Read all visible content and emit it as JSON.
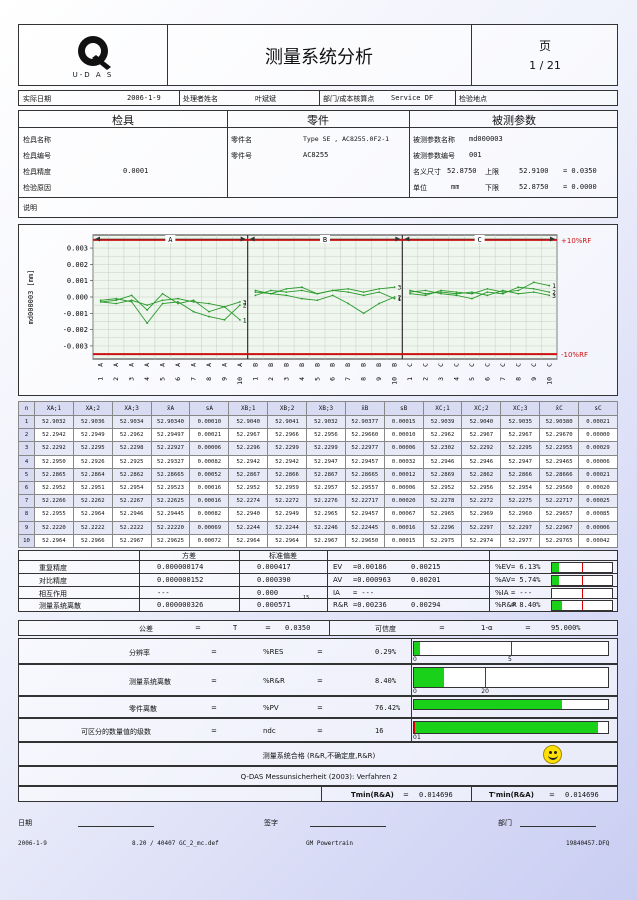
{
  "header": {
    "logo_text": "U-D A S",
    "title": "测量系统分析",
    "page_label": "页",
    "page_value": "1 / 21"
  },
  "info_row": {
    "date_label": "实际日期",
    "date_value": "2006-1-9",
    "operator_label": "处理者姓名",
    "operator_value": "叶斌斌",
    "dept_label": "部门/成本核算点",
    "dept_value": "Service DF",
    "inspect_label": "检验地点",
    "inspect_value": ""
  },
  "sections": {
    "gauge": "检具",
    "part": "零件",
    "characteristic": "被测参数"
  },
  "gauge": {
    "name_label": "检具名称",
    "name_value": "",
    "number_label": "检具编号",
    "number_value": "",
    "resolution_label": "检具精度",
    "resolution_value": "0.0001",
    "reason_label": "检验原因",
    "reason_value": ""
  },
  "part": {
    "name_label": "零件名",
    "name_value": "Type SE , AC8255.0F2-1",
    "number_label": "零件号",
    "number_value": "AC8255"
  },
  "characteristic": {
    "name_label": "被测参数名称",
    "name_value": "md000003",
    "number_label": "被测参数编号",
    "number_value": "001",
    "nominal_label": "名义尺寸",
    "nominal_value": "52.8750",
    "usl_label": "上限",
    "usl_value": "52.9100",
    "usl_dev": "= 0.0350",
    "unit_label": "单位",
    "unit_value": "mm",
    "lsl_label": "下限",
    "lsl_value": "52.8750",
    "lsl_dev": "= 0.0000",
    "remark_label": "说明"
  },
  "chart_data": {
    "type": "line",
    "ylabel": "md000003 [mm]",
    "ylim": [
      -0.0038,
      0.0038
    ],
    "yticks": [
      "0.003",
      "0.002",
      "0.001",
      "0.000",
      "-0.001",
      "-0.002",
      "-0.003"
    ],
    "upper_limit_label": "+10%RF",
    "lower_limit_label": "-10%RF",
    "limits": [
      0.0035,
      -0.0035
    ],
    "groups": [
      "A",
      "B",
      "C"
    ],
    "parts_per_group": 10,
    "x_letters": [
      "A",
      "A",
      "A",
      "A",
      "A",
      "A",
      "A",
      "A",
      "A",
      "A",
      "B",
      "B",
      "B",
      "B",
      "B",
      "B",
      "B",
      "B",
      "B",
      "B",
      "C",
      "C",
      "C",
      "C",
      "C",
      "C",
      "C",
      "C",
      "C",
      "C"
    ],
    "x_numbers": [
      "1",
      "2",
      "3",
      "4",
      "5",
      "6",
      "7",
      "8",
      "9",
      "10",
      "1",
      "2",
      "3",
      "4",
      "5",
      "6",
      "7",
      "8",
      "9",
      "10",
      "1",
      "2",
      "3",
      "4",
      "5",
      "6",
      "7",
      "8",
      "9",
      "10"
    ],
    "series": [
      {
        "name": "1",
        "group": "A",
        "values": [
          -0.0003,
          -0.0004,
          -0.0002,
          -0.0005,
          -0.0002,
          -0.0001,
          -0.0003,
          -0.0004,
          -0.0006,
          -0.0014
        ]
      },
      {
        "name": "2",
        "group": "A",
        "values": [
          -0.0002,
          -0.0001,
          -0.0003,
          -0.0016,
          -0.0004,
          -0.0003,
          -0.0009,
          -0.0012,
          -0.0014,
          -0.0005
        ]
      },
      {
        "name": "3",
        "group": "A",
        "values": [
          -0.0003,
          -0.0002,
          0.0001,
          -0.0008,
          0.0002,
          -0.0004,
          -0.0002,
          -0.0009,
          -0.0006,
          -0.0003
        ]
      },
      {
        "name": "1",
        "group": "B",
        "values": [
          0.0001,
          0.0004,
          0.0003,
          0.0004,
          0.0002,
          0.0004,
          0.0003,
          0.0001,
          0.0003,
          -0.0001
        ]
      },
      {
        "name": "2",
        "group": "B",
        "values": [
          0.0003,
          0.0002,
          0.0001,
          -0.0001,
          -0.0002,
          0.0001,
          -0.0004,
          -0.001,
          -0.0004,
          0.0
        ]
      },
      {
        "name": "3",
        "group": "B",
        "values": [
          0.0004,
          0.0002,
          0.0005,
          0.0006,
          0.0002,
          0.0004,
          0.0005,
          0.0003,
          0.0005,
          0.0006
        ]
      },
      {
        "name": "1",
        "group": "C",
        "values": [
          0.0002,
          0.0001,
          0.0004,
          0.0003,
          0.0002,
          0.0005,
          0.0003,
          0.0004,
          0.0009,
          0.0007
        ]
      },
      {
        "name": "2",
        "group": "C",
        "values": [
          0.0003,
          0.0004,
          0.0002,
          0.0001,
          -0.0001,
          0.0003,
          0.0002,
          0.0006,
          0.0005,
          0.0003
        ]
      },
      {
        "name": "3",
        "group": "C",
        "values": [
          0.0004,
          0.0002,
          0.0003,
          0.0002,
          0.0003,
          0.0001,
          0.0004,
          0.0002,
          0.0003,
          0.0001
        ]
      }
    ]
  },
  "data_table": {
    "headers": [
      "n",
      "XA;1",
      "XA;2",
      "XA;3",
      "x̄A",
      "sA",
      "XB;1",
      "XB;2",
      "XB;3",
      "x̄B",
      "sB",
      "XC;1",
      "XC;2",
      "XC;3",
      "x̄C",
      "sC"
    ],
    "rows": [
      [
        "1",
        "52.9032",
        "52.9036",
        "52.9034",
        "52.90340",
        "0.00010",
        "52.9040",
        "52.9041",
        "52.9032",
        "52.90377",
        "0.00015",
        "52.9039",
        "52.9040",
        "52.9035",
        "52.90380",
        "0.00021"
      ],
      [
        "2",
        "52.2942",
        "52.2949",
        "52.2962",
        "52.29497",
        "0.00021",
        "52.2967",
        "52.2966",
        "52.2956",
        "52.29660",
        "0.00010",
        "52.2962",
        "52.2967",
        "52.2967",
        "52.29670",
        "0.00000"
      ],
      [
        "3",
        "52.2292",
        "52.2295",
        "52.2298",
        "52.22927",
        "0.00006",
        "52.2296",
        "52.2299",
        "52.2299",
        "52.22977",
        "0.00006",
        "52.2302",
        "52.2292",
        "52.2295",
        "52.22955",
        "0.00029"
      ],
      [
        "4",
        "52.2950",
        "52.2926",
        "52.2925",
        "52.29327",
        "0.00082",
        "52.2942",
        "52.2942",
        "52.2947",
        "52.29457",
        "0.00032",
        "52.2946",
        "52.2946",
        "52.2947",
        "52.29465",
        "0.00006"
      ],
      [
        "5",
        "52.2865",
        "52.2864",
        "52.2862",
        "52.28665",
        "0.00052",
        "52.2867",
        "52.2866",
        "52.2867",
        "52.28665",
        "0.00012",
        "52.2869",
        "52.2862",
        "52.2866",
        "52.28666",
        "0.00021"
      ],
      [
        "6",
        "52.2952",
        "52.2951",
        "52.2954",
        "52.29523",
        "0.00016",
        "52.2952",
        "52.2959",
        "52.2957",
        "52.29557",
        "0.00006",
        "52.2952",
        "52.2956",
        "52.2954",
        "52.29560",
        "0.00020"
      ],
      [
        "7",
        "52.2266",
        "52.2262",
        "52.2267",
        "52.22625",
        "0.00016",
        "52.2274",
        "52.2272",
        "52.2276",
        "52.22717",
        "0.00020",
        "52.2278",
        "52.2272",
        "52.2275",
        "52.22717",
        "0.00025"
      ],
      [
        "8",
        "52.2955",
        "52.2964",
        "52.2946",
        "52.29445",
        "0.00082",
        "52.2940",
        "52.2949",
        "52.2965",
        "52.29457",
        "0.00067",
        "52.2965",
        "52.2969",
        "52.2960",
        "52.29657",
        "0.00085"
      ],
      [
        "9",
        "52.2220",
        "52.2222",
        "52.2222",
        "52.22220",
        "0.00069",
        "52.2244",
        "52.2244",
        "52.2246",
        "52.22445",
        "0.00016",
        "52.2296",
        "52.2297",
        "52.2297",
        "52.22967",
        "0.00006"
      ],
      [
        "10",
        "52.2964",
        "52.2966",
        "52.2967",
        "52.29625",
        "0.00072",
        "52.2964",
        "52.2964",
        "52.2967",
        "52.29650",
        "0.00015",
        "52.2975",
        "52.2974",
        "52.2977",
        "52.29765",
        "0.00042"
      ]
    ]
  },
  "variance": {
    "col_variance": "方差",
    "col_std": "标准偏差",
    "rows": [
      {
        "label": "重复精度",
        "variance": "0.000000174",
        "std": "0.000417",
        "sym": "EV",
        "lo": "=0.00186",
        "mid": "0.00215",
        "hi": "0.00215",
        "pct_label": "%EV",
        "pct": "= 6.13%",
        "fill": 0.0613,
        "limit": 0.25
      },
      {
        "label": "对比精度",
        "variance": "0.000000152",
        "std": "0.000390",
        "sym": "AV",
        "lo": "=0.000963",
        "mid": "0.00201",
        "hi": "0.00201",
        "pct_label": "%AV",
        "pct": "= 5.74%",
        "fill": 0.0574,
        "limit": 0.25
      },
      {
        "label": "相互作用",
        "variance": "---",
        "std": "0.000",
        "sym": "IA",
        "lo": "= ---",
        "mid": "",
        "hi": "",
        "pct_label": "%IA",
        "pct": "= ---",
        "fill": 0,
        "limit": 0.25
      },
      {
        "label": "测量系统离散",
        "variance": "0.000000326",
        "std": "0.000571",
        "sym": "R&R",
        "lo": "=0.00236",
        "mid": "0.00294",
        "hi": "0.00294",
        "pct_label": "%R&R",
        "pct": "= 8.40%",
        "fill": 0.084,
        "limit": 0.25
      }
    ],
    "std_note": "15"
  },
  "tolerance": {
    "label": "公差",
    "eq": "=",
    "sym": "T",
    "eq2": "=",
    "value": "0.0350",
    "conf_label": "可信度",
    "conf_eq": "=",
    "conf_sym": "1-α",
    "conf_eq2": "=",
    "conf_value": "95.000%"
  },
  "results": [
    {
      "label": "分辨率",
      "eq": "=",
      "sym": "%RES",
      "eq2": "=",
      "value": "0.29%",
      "fill": 0.029,
      "limit_value": 0.5,
      "scale_max": 1.0,
      "tick0": "0",
      "tick1": "5"
    },
    {
      "label": "测量系统离散",
      "eq": "=",
      "sym": "%R&R",
      "eq2": "=",
      "value": "8.40%",
      "fill": 0.084,
      "limit_value": 0.2,
      "scale_max": 0.55,
      "tick0": "0",
      "tick1": "20"
    },
    {
      "label": "零件离散",
      "eq": "=",
      "sym": "%PV",
      "eq2": "=",
      "value": "76.42%",
      "fill": 0.7642,
      "limit_value": null,
      "scale_max": 1.0,
      "tick0": "",
      "tick1": ""
    },
    {
      "label": "可区分的数量值的级数",
      "eq": "=",
      "sym": "ndc",
      "eq2": "=",
      "value": "16",
      "fill": 0.95,
      "limit_value": 0.0,
      "scale_max": 1.0,
      "tick0": "0",
      "tick1": "1"
    }
  ],
  "verdict": {
    "text": "测量系统合格 (R&R,不确定度,R&R)",
    "smiley": "smiley-icon",
    "standard": "Q-DAS Messunsicherheit (2003): Verfahren 2",
    "tmin_ma_label": "Tmin(R&A)",
    "tmin_ma_eq": "=",
    "tmin_ma_value": "0.014696",
    "tmin_ma2_label": "T'min(R&A)",
    "tmin_ma2_eq": "=",
    "tmin_ma2_value": "0.014696"
  },
  "footer": {
    "date_label": "日期",
    "sign_label": "签字",
    "dept_label": "部门",
    "date_value": "2006-1-9",
    "version": "8.20 / 40407 GC_2_mc.def",
    "company": "GM Powertrain",
    "file": "19840457.DFQ"
  },
  "colors": {
    "limit_line": "#cc1111",
    "plot_line": "#2a9a2a",
    "bar_fill": "#19d119",
    "header_bg": "#d9dbf3"
  }
}
